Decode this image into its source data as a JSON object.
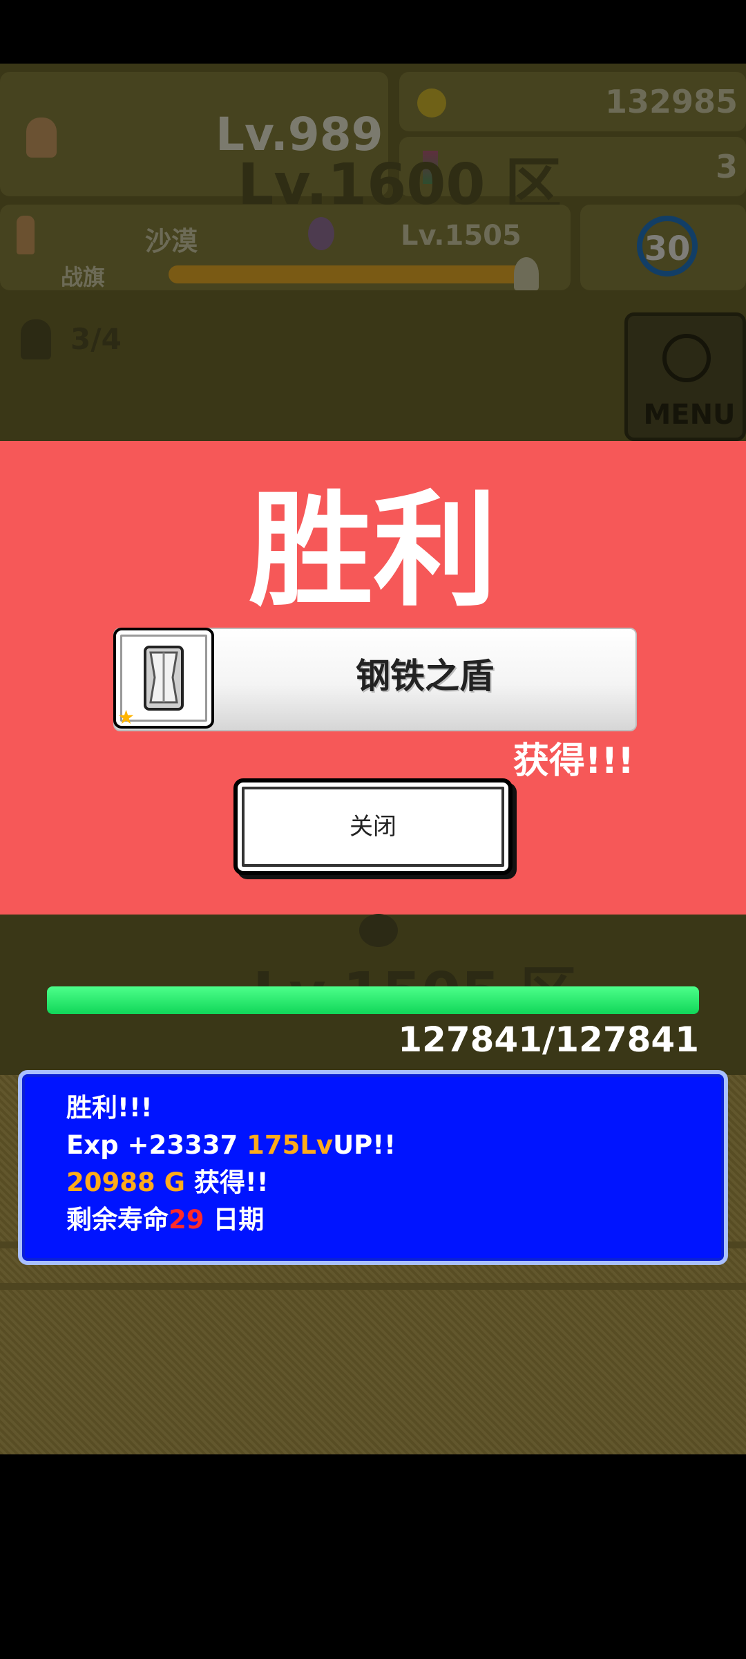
{
  "colors": {
    "overlay": "#f65858",
    "message_box": "#0014ff",
    "hp_fill": "#11d659",
    "accent_gold": "#ffab1a",
    "accent_red": "#ff2a2a"
  },
  "header": {
    "player_level": "Lv.989",
    "gold": "132985",
    "hourglass_count": "3",
    "zone_label": "Lv.1600 区",
    "area_name": "沙漠",
    "enemy_level": "Lv.1505",
    "flag_label": "战旗",
    "timer_value": "30",
    "party_count": "3/4",
    "menu_label": "MENU",
    "icons": [
      "hero-sprite-icon",
      "gold-coin-icon",
      "hourglass-icon",
      "flag-statue-icon",
      "enemy-sprite-icon",
      "runner-icon",
      "timer-ring-icon",
      "party-icon",
      "sword-menu-icon"
    ]
  },
  "victory": {
    "title": "胜利",
    "item_name": "钢铁之盾",
    "item_icon": "steel-shield-icon",
    "obtained": "获得!!!",
    "close_label": "关闭"
  },
  "battle": {
    "zone_label": "Lv.1505 区",
    "hp_text": "127841/127841",
    "hp_fraction": 1.0
  },
  "messages": {
    "line1": "胜利!!!",
    "exp_prefix": "Exp +23337 ",
    "exp_levelup": "175Lv",
    "exp_suffix": "UP!!",
    "gold_amount": "20988 G",
    "gold_suffix": " 获得!!",
    "life_prefix": " 剩余寿命",
    "life_days": "29",
    "life_suffix": " 日期"
  }
}
